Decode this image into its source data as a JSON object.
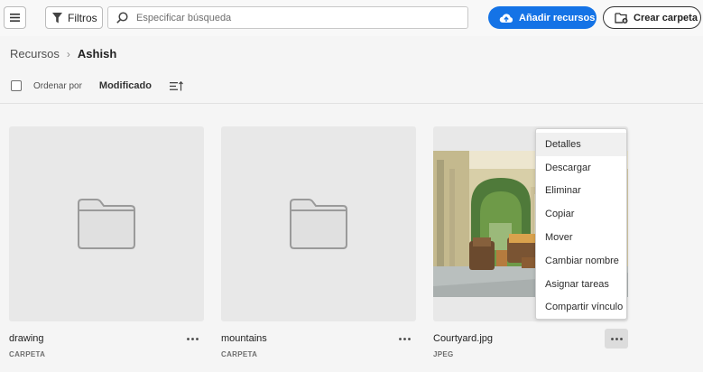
{
  "toolbar": {
    "filters_label": "Filtros",
    "search_placeholder": "Especificar búsqueda",
    "add_resources_label": "Añadir recursos",
    "create_folder_label": "Crear carpeta",
    "accent_color": "#1473e6"
  },
  "breadcrumb": {
    "root": "Recursos",
    "separator": "›",
    "current": "Ashish"
  },
  "sort": {
    "label": "Ordenar por",
    "value": "Modificado"
  },
  "items": [
    {
      "name": "drawing",
      "type": "CARPETA",
      "icon": "folder-icon"
    },
    {
      "name": "mountains",
      "type": "CARPETA",
      "icon": "folder-icon"
    },
    {
      "name": "Courtyard.jpg",
      "type": "JPEG",
      "icon": "image-thumbnail"
    }
  ],
  "context_menu": {
    "items": [
      "Detalles",
      "Descargar",
      "Eliminar",
      "Copiar",
      "Mover",
      "Cambiar nombre",
      "Asignar tareas",
      "Compartir vínculo"
    ]
  }
}
